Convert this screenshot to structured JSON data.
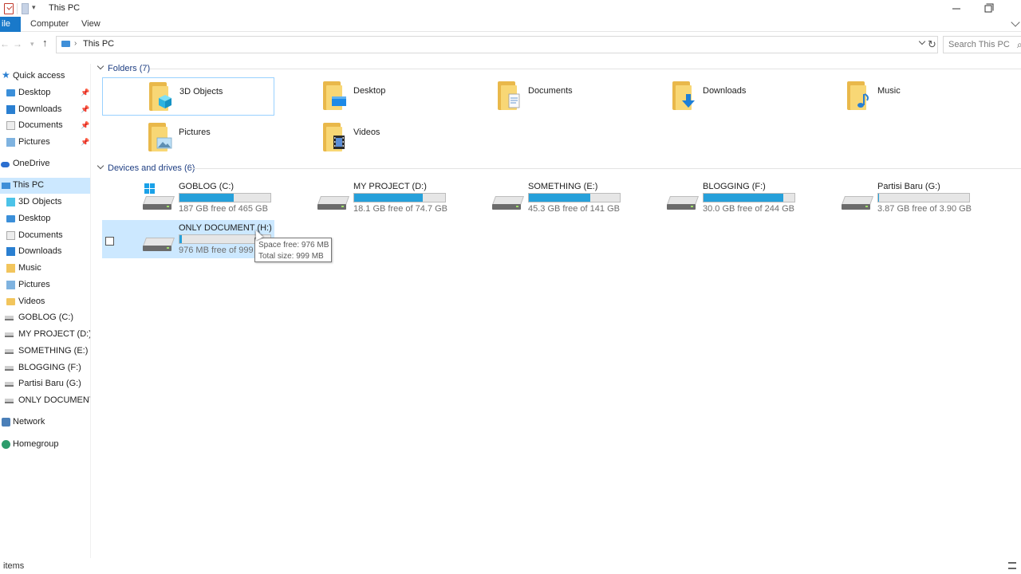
{
  "window": {
    "title": "This PC"
  },
  "ribbon": {
    "file_label": "ile",
    "tabs": [
      "Computer",
      "View"
    ]
  },
  "address": {
    "path": "This PC",
    "search_placeholder": "Search This PC"
  },
  "navpane": {
    "quick_access": "Quick access",
    "quick_items": [
      "Desktop",
      "Downloads",
      "Documents",
      "Pictures"
    ],
    "onedrive": "OneDrive",
    "this_pc": "This PC",
    "pc_items": [
      "3D Objects",
      "Desktop",
      "Documents",
      "Downloads",
      "Music",
      "Pictures",
      "Videos",
      "GOBLOG (C:)",
      "MY PROJECT (D:)",
      "SOMETHING (E:)",
      "BLOGGING (F:)",
      "Partisi Baru (G:)",
      "ONLY DOCUMENT ("
    ],
    "network": "Network",
    "homegroup": "Homegroup"
  },
  "content": {
    "folders_header": "Folders (7)",
    "folders": [
      "3D Objects",
      "Desktop",
      "Documents",
      "Downloads",
      "Music",
      "Pictures",
      "Videos"
    ],
    "devices_header": "Devices and drives (6)",
    "drives": [
      {
        "name": "GOBLOG (C:)",
        "free": "187 GB free of 465 GB",
        "used_fraction": 0.598
      },
      {
        "name": "MY PROJECT (D:)",
        "free": "18.1 GB free of 74.7 GB",
        "used_fraction": 0.758
      },
      {
        "name": "SOMETHING (E:)",
        "free": "45.3 GB free of 141 GB",
        "used_fraction": 0.679
      },
      {
        "name": "BLOGGING (F:)",
        "free": "30.0 GB free of 244 GB",
        "used_fraction": 0.877
      },
      {
        "name": "Partisi Baru (G:)",
        "free": "3.87 GB free of 3.90 GB",
        "used_fraction": 0.008
      },
      {
        "name": "ONLY DOCUMENT (H:)",
        "free": "976 MB free of 999 MB",
        "used_fraction": 0.023
      }
    ],
    "tooltip": {
      "line1": "Space free: 976 MB",
      "line2": "Total size: 999 MB"
    }
  },
  "status": {
    "text": "items"
  },
  "colors": {
    "accent": "#1979ca",
    "selection": "#cce8ff",
    "bar_fill": "#26a0da",
    "section_text": "#1e3e82"
  }
}
